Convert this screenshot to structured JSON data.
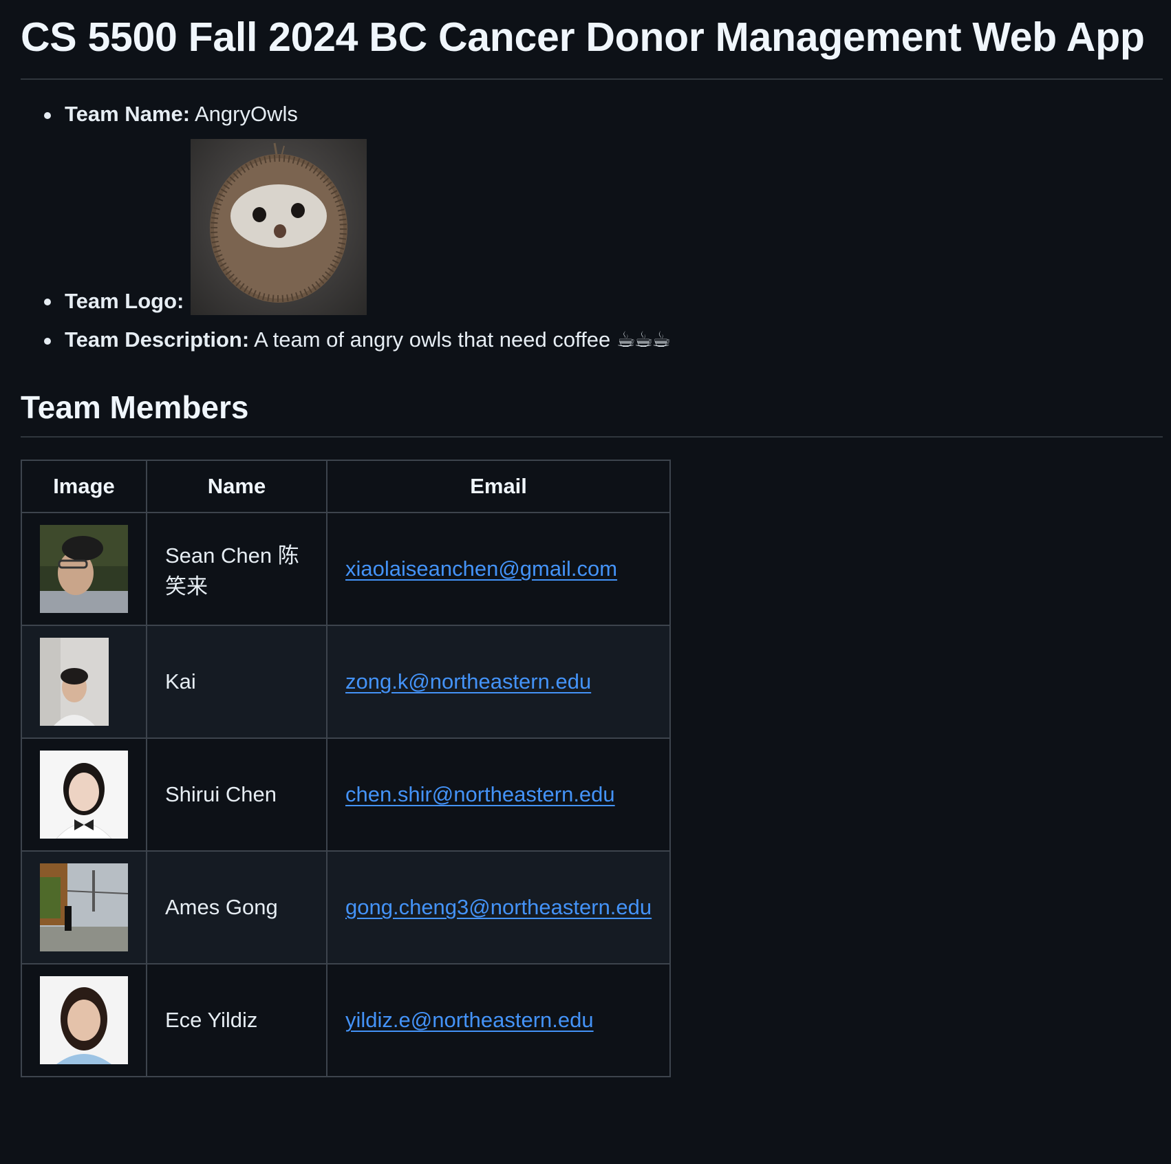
{
  "title": "CS 5500 Fall 2024 BC Cancer Donor Management Web App",
  "team": {
    "name_label": "Team Name:",
    "name_value": "AngryOwls",
    "logo_label": "Team Logo:",
    "logo_icon": "owl-logo",
    "description_label": "Team Description:",
    "description_value": "A team of angry owls that need coffee",
    "description_emoji": "☕☕☕"
  },
  "members_section": {
    "heading": "Team Members",
    "columns": [
      "Image",
      "Name",
      "Email"
    ],
    "rows": [
      {
        "name": "Sean Chen 陈笑来",
        "email": "xiaolaiseanchen@gmail.com"
      },
      {
        "name": "Kai",
        "email": "zong.k@northeastern.edu"
      },
      {
        "name": "Shirui Chen",
        "email": "chen.shir@northeastern.edu"
      },
      {
        "name": "Ames Gong",
        "email": "gong.cheng3@northeastern.edu"
      },
      {
        "name": "Ece Yildiz",
        "email": "yildiz.e@northeastern.edu"
      }
    ]
  },
  "colors": {
    "background": "#0d1117",
    "text": "#e6edf3",
    "link": "#4493f8",
    "border": "#3d444d",
    "row_alt": "#151b23"
  }
}
